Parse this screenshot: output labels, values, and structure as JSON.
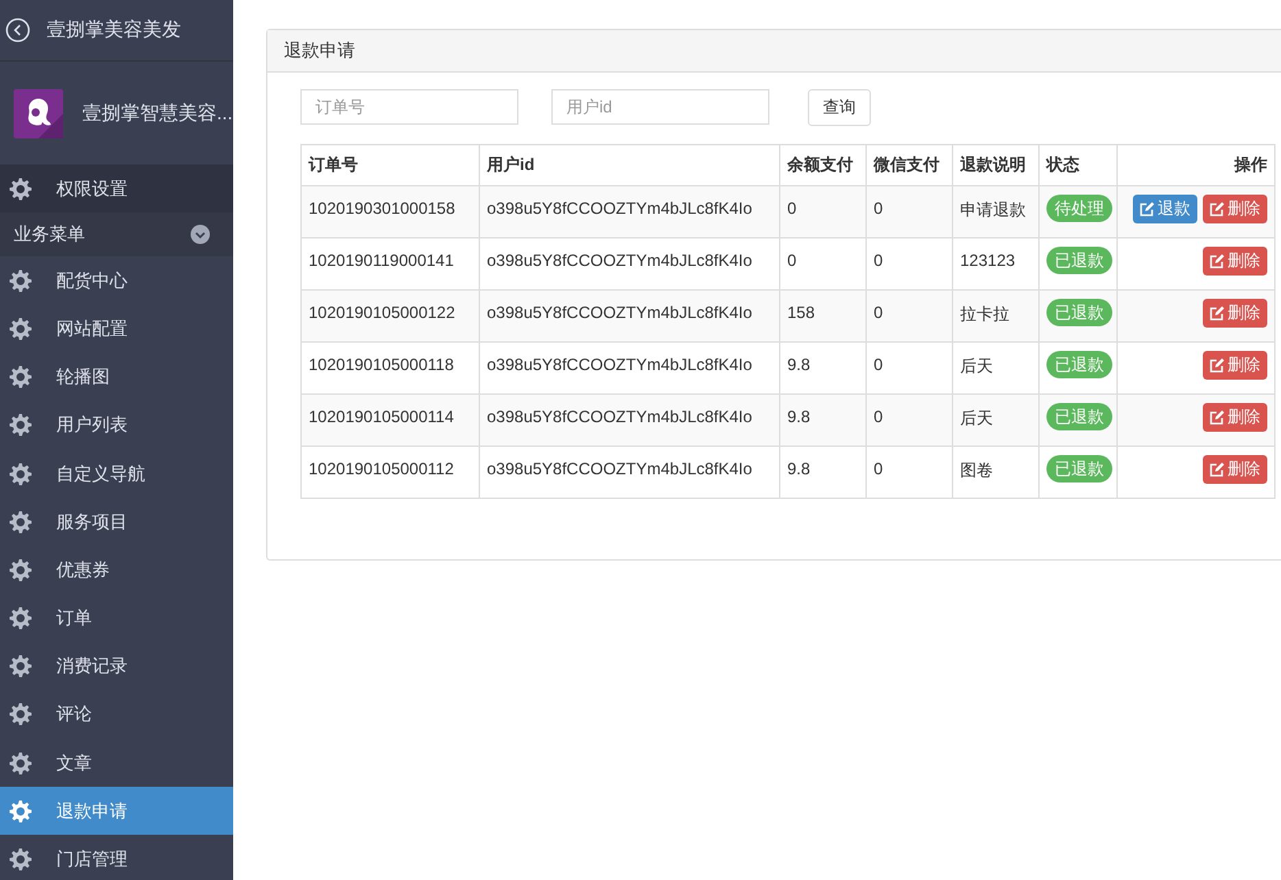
{
  "sidebar": {
    "title": "壹捌掌美容美发",
    "brand": "壹捌掌智慧美容...",
    "items": [
      {
        "label": "权限设置",
        "kind": "top",
        "selected": false
      },
      {
        "label": "业务菜单",
        "kind": "section"
      },
      {
        "label": "配货中心",
        "kind": "item",
        "selected": false
      },
      {
        "label": "网站配置",
        "kind": "item",
        "selected": false
      },
      {
        "label": "轮播图",
        "kind": "item",
        "selected": false
      },
      {
        "label": "用户列表",
        "kind": "item",
        "selected": false
      },
      {
        "label": "自定义导航",
        "kind": "item",
        "selected": false
      },
      {
        "label": "服务项目",
        "kind": "item",
        "selected": false
      },
      {
        "label": "优惠券",
        "kind": "item",
        "selected": false
      },
      {
        "label": "订单",
        "kind": "item",
        "selected": false
      },
      {
        "label": "消费记录",
        "kind": "item",
        "selected": false
      },
      {
        "label": "评论",
        "kind": "item",
        "selected": false
      },
      {
        "label": "文章",
        "kind": "item",
        "selected": false
      },
      {
        "label": "退款申请",
        "kind": "item",
        "selected": true
      },
      {
        "label": "门店管理",
        "kind": "item",
        "selected": false
      }
    ]
  },
  "panel": {
    "title": "退款申请",
    "search": [
      {
        "placeholder": "订单号"
      },
      {
        "placeholder": "用户id"
      }
    ],
    "search_button": "查询",
    "table": {
      "columns": [
        "订单号",
        "用户id",
        "余额支付",
        "微信支付",
        "退款说明",
        "状态",
        "操作"
      ],
      "rows": [
        {
          "order": "1020190301000158",
          "user": "o398u5Y8fCCOOZTYm4bJLc8fK4Io",
          "balance": "0",
          "wechat": "0",
          "note": "申请退款",
          "status": "待处理",
          "actions": [
            {
              "label": "退款",
              "kind": "refund"
            },
            {
              "label": "删除",
              "kind": "delete"
            }
          ]
        },
        {
          "order": "1020190119000141",
          "user": "o398u5Y8fCCOOZTYm4bJLc8fK4Io",
          "balance": "0",
          "wechat": "0",
          "note": "123123",
          "status": "已退款",
          "actions": [
            {
              "label": "删除",
              "kind": "delete"
            }
          ]
        },
        {
          "order": "1020190105000122",
          "user": "o398u5Y8fCCOOZTYm4bJLc8fK4Io",
          "balance": "158",
          "wechat": "0",
          "note": "拉卡拉",
          "status": "已退款",
          "actions": [
            {
              "label": "删除",
              "kind": "delete"
            }
          ]
        },
        {
          "order": "1020190105000118",
          "user": "o398u5Y8fCCOOZTYm4bJLc8fK4Io",
          "balance": "9.8",
          "wechat": "0",
          "note": "后天",
          "status": "已退款",
          "actions": [
            {
              "label": "删除",
              "kind": "delete"
            }
          ]
        },
        {
          "order": "1020190105000114",
          "user": "o398u5Y8fCCOOZTYm4bJLc8fK4Io",
          "balance": "9.8",
          "wechat": "0",
          "note": "后天",
          "status": "已退款",
          "actions": [
            {
              "label": "删除",
              "kind": "delete"
            }
          ]
        },
        {
          "order": "1020190105000112",
          "user": "o398u5Y8fCCOOZTYm4bJLc8fK4Io",
          "balance": "9.8",
          "wechat": "0",
          "note": "图卷",
          "status": "已退款",
          "actions": [
            {
              "label": "删除",
              "kind": "delete"
            }
          ]
        }
      ]
    }
  }
}
